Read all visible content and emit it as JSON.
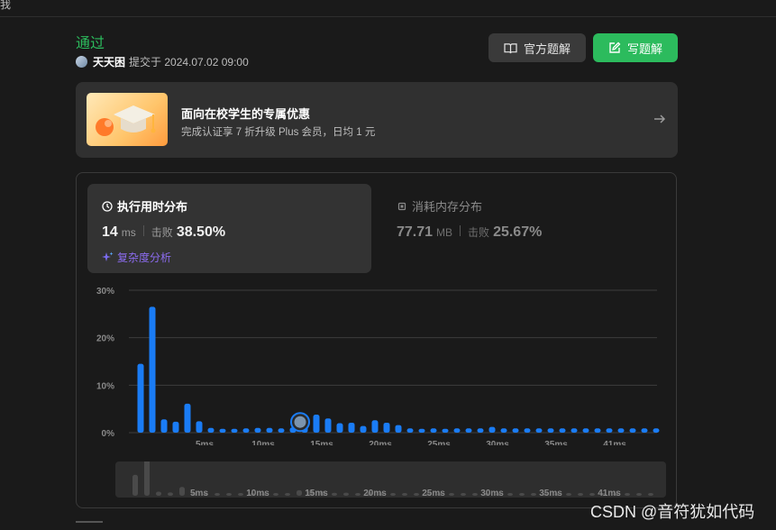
{
  "topbar": {
    "fragment": "我"
  },
  "submission": {
    "status": "通过",
    "user": "天天困",
    "submitted_text": "提交于 2024.07.02 09:00"
  },
  "actions": {
    "official_label": "官方题解",
    "write_label": "写题解"
  },
  "promo": {
    "title": "面向在校学生的专属优惠",
    "subtitle": "完成认证享 7 折升级 Plus 会员，日均 1 元"
  },
  "runtime": {
    "tab_label": "执行用时分布",
    "value": "14",
    "unit": "ms",
    "beats_label": "击败",
    "beats_value": "38.50%",
    "analysis_label": "复杂度分析"
  },
  "memory": {
    "tab_label": "消耗内存分布",
    "value": "77.71",
    "unit": "MB",
    "beats_label": "击败",
    "beats_value": "25.67%"
  },
  "chart_data": {
    "type": "bar",
    "y_ticks": [
      "30%",
      "20%",
      "10%",
      "0%"
    ],
    "ylim": [
      0,
      30
    ],
    "x_tick_labels": [
      {
        "label": "5ms",
        "index": 5
      },
      {
        "label": "10ms",
        "index": 10
      },
      {
        "label": "15ms",
        "index": 15
      },
      {
        "label": "20ms",
        "index": 20
      },
      {
        "label": "25ms",
        "index": 25
      },
      {
        "label": "30ms",
        "index": 30
      },
      {
        "label": "35ms",
        "index": 35
      },
      {
        "label": "41ms",
        "index": 40
      }
    ],
    "values": [
      14.5,
      26.5,
      2.8,
      2.3,
      6.1,
      2.4,
      1.0,
      0.8,
      0.8,
      0.9,
      1.0,
      1.0,
      0.9,
      1.1,
      3.8,
      3.8,
      3.0,
      2.0,
      2.1,
      1.4,
      2.6,
      2.1,
      1.6,
      0.9,
      0.8,
      0.9,
      0.8,
      0.9,
      0.9,
      0.9,
      1.2,
      0.9,
      0.9,
      0.9,
      0.9,
      0.9,
      0.9,
      0.9,
      0.9,
      0.9,
      0.9,
      0.9,
      0.9,
      0.9,
      0.9
    ],
    "highlight_index": 13,
    "bar_color": "#1a7cf5",
    "grid": true
  },
  "watermark": "CSDN @音符犹如代码"
}
